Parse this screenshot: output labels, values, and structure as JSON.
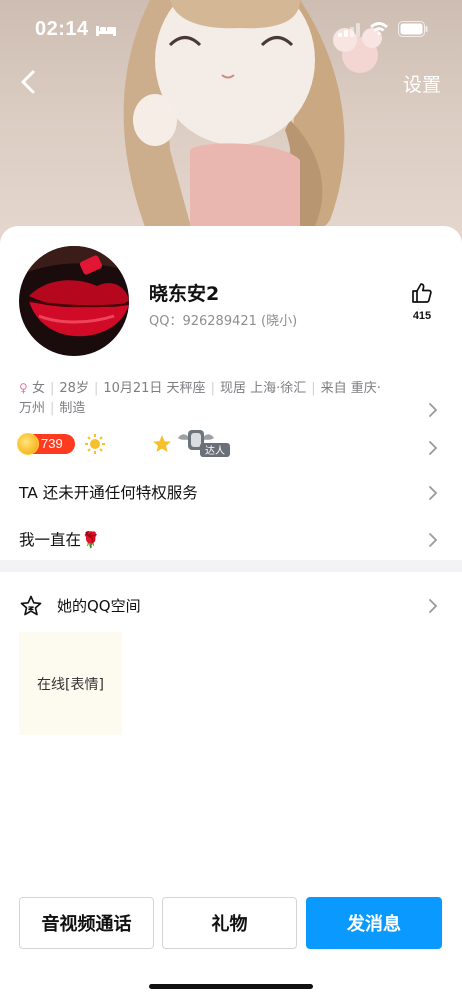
{
  "status_bar": {
    "time": "02:14",
    "icons": [
      "bed-icon",
      "signal-icon",
      "wifi-icon",
      "battery-icon"
    ]
  },
  "nav": {
    "back_icon": "chevron-left-icon",
    "settings_label": "设置"
  },
  "profile": {
    "nickname": "晓东安2",
    "qq_line": "QQ：926289421 (晓小)",
    "like_count": "415",
    "info": {
      "gender": "女",
      "age": "28岁",
      "birthday": "10月21日 天秤座",
      "location": "现居 上海·徐汇",
      "hometown_prefix": "来自 重庆·",
      "hometown_rest": "万州",
      "occupation": "制造"
    },
    "badges": {
      "coin_value": "739",
      "talent_label": "达人"
    },
    "privilege_text": "TA 还未开通任何特权服务",
    "signature": "我一直在🌹"
  },
  "qzone": {
    "title": "她的QQ空间",
    "tile_text": "在线[表情]"
  },
  "actions": {
    "video_call": "音视频通话",
    "gift": "礼物",
    "send_message": "发消息"
  },
  "colors": {
    "accent": "#0a99ff",
    "coin_badge": "#ff3b1f"
  }
}
